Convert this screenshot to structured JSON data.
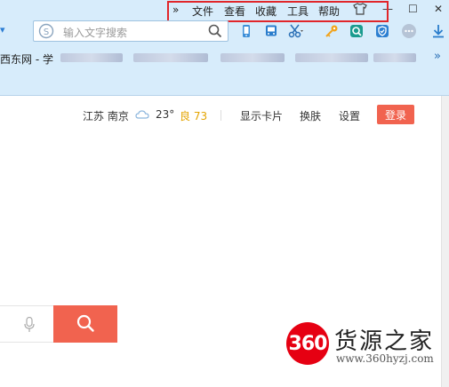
{
  "menubar": {
    "chevron": "»",
    "items": [
      "文件",
      "查看",
      "收藏",
      "工具",
      "帮助"
    ],
    "shirt_icon": "shirt-icon",
    "window_buttons": [
      "—",
      "☐",
      "✕"
    ]
  },
  "toolbar": {
    "search_placeholder": "输入文字搜索",
    "left_arrow": "▾",
    "chevron_more": "»"
  },
  "bookmarks": {
    "first_label": "西东网 - 学"
  },
  "topnav": {
    "location": "江苏 南京",
    "temperature": "23°",
    "air_quality": "良 73",
    "show_card": "显示卡片",
    "change_skin": "换肤",
    "settings": "设置",
    "login": "登录"
  },
  "watermark": {
    "logo_text": "360",
    "title": "货源之家",
    "url": "www.360hyzj.com"
  },
  "colors": {
    "accent": "#f1634f",
    "chrome_bg": "#d7ecfb",
    "highlight_frame": "#e1262a",
    "air_quality": "#e4a400"
  }
}
